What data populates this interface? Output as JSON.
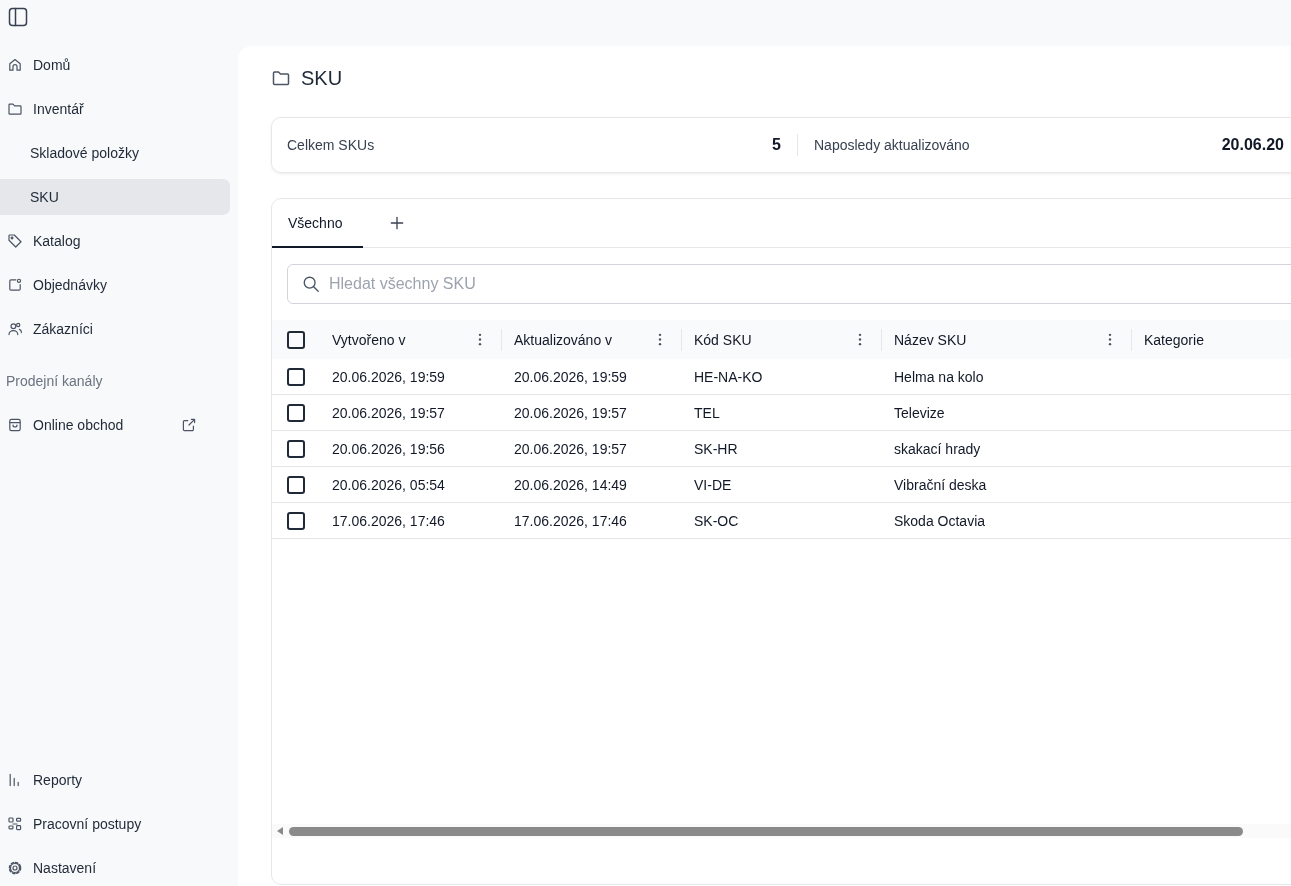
{
  "sidebar": {
    "nav": [
      {
        "label": "Domů",
        "selected": false
      },
      {
        "label": "Inventář",
        "selected": false,
        "children": [
          {
            "label": "Skladové položky",
            "selected": false
          },
          {
            "label": "SKU",
            "selected": true
          }
        ]
      },
      {
        "label": "Katalog",
        "selected": false
      },
      {
        "label": "Objednávky",
        "selected": false
      },
      {
        "label": "Zákazníci",
        "selected": false
      }
    ],
    "section_title": "Prodejní kanály",
    "channels": [
      {
        "label": "Online obchod",
        "selected": false
      }
    ],
    "footer_nav": [
      {
        "label": "Reporty",
        "selected": false
      },
      {
        "label": "Pracovní postupy",
        "selected": false
      },
      {
        "label": "Nastavení",
        "selected": false
      }
    ]
  },
  "page": {
    "title": "SKU"
  },
  "stats": [
    {
      "label": "Celkem SKUs",
      "value": "5"
    },
    {
      "label": "Naposledy aktualizováno",
      "value": "20.06.20"
    }
  ],
  "tabs": [
    {
      "label": "Všechno",
      "selected": true
    }
  ],
  "search": {
    "placeholder": "Hledat všechny SKU"
  },
  "table": {
    "select_all": {
      "checked": false
    },
    "columns": [
      {
        "label": "Vytvořeno v",
        "menu": true
      },
      {
        "label": "Aktualizováno v",
        "menu": true
      },
      {
        "label": "Kód SKU",
        "menu": true
      },
      {
        "label": "Název SKU",
        "menu": true
      },
      {
        "label": "Kategorie",
        "menu": false
      }
    ],
    "rows": [
      {
        "selected": false,
        "cells": [
          "20.06.2026, 19:59",
          "20.06.2026, 19:59",
          "HE-NA-KO",
          "Helma na kolo"
        ]
      },
      {
        "selected": false,
        "cells": [
          "20.06.2026, 19:57",
          "20.06.2026, 19:57",
          "TEL",
          "Televize"
        ]
      },
      {
        "selected": false,
        "cells": [
          "20.06.2026, 19:56",
          "20.06.2026, 19:57",
          "SK-HR",
          "skakací hrady"
        ]
      },
      {
        "selected": false,
        "cells": [
          "20.06.2026, 05:54",
          "20.06.2026, 14:49",
          "VI-DE",
          "Vibrační deska"
        ]
      },
      {
        "selected": false,
        "cells": [
          "17.06.2026, 17:46",
          "17.06.2026, 17:46",
          "SK-OC",
          "Skoda Octavia"
        ]
      }
    ]
  }
}
